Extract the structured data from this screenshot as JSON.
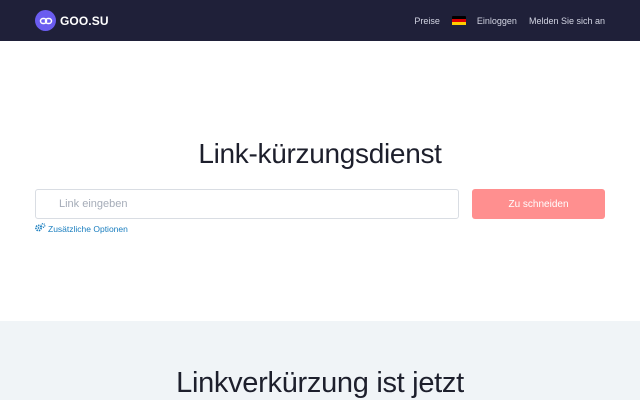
{
  "header": {
    "brand_name": "GOO.SU",
    "logo_icon": "link-icon",
    "nav": {
      "pricing_label": "Preise",
      "language_flag": "germany-flag-icon",
      "flag_colors": [
        "#000000",
        "#dd0000",
        "#ffce00"
      ],
      "login_label": "Einloggen",
      "signup_label": "Melden Sie sich an"
    },
    "background_color": "#1f2039"
  },
  "hero": {
    "title": "Link-kürzungsdienst",
    "url_input": {
      "placeholder": "Link eingeben",
      "value": ""
    },
    "shorten_button_label": "Zu schneiden",
    "shorten_button_color": "#ff8f8f",
    "options_link": {
      "icon": "gears-icon",
      "label": "Zusätzliche Optionen"
    }
  },
  "section_2": {
    "title": "Linkverkürzung ist jetzt",
    "background_color": "#f0f4f7"
  }
}
